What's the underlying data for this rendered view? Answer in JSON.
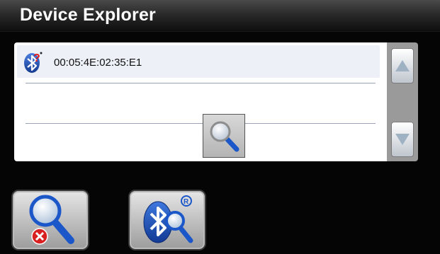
{
  "window": {
    "title": "Device Explorer"
  },
  "device_list": {
    "items": [
      {
        "address": "00:05:4E:02:35:E1",
        "icon": "bluetooth-unknown-icon"
      }
    ]
  },
  "controls": {
    "search_icon": "magnifier-icon",
    "scroll_up_icon": "arrow-up-icon",
    "scroll_down_icon": "arrow-down-icon",
    "stop_search_icon": "search-stop-icon",
    "bluetooth_search_icon": "bluetooth-search-icon"
  },
  "colors": {
    "background": "#050505",
    "panel": "#ffffff",
    "selected_row": "#eef0f8",
    "scrollbar": "#9a9a9a",
    "bluetooth_blue": "#1e4fb4",
    "error_red": "#d82020"
  }
}
